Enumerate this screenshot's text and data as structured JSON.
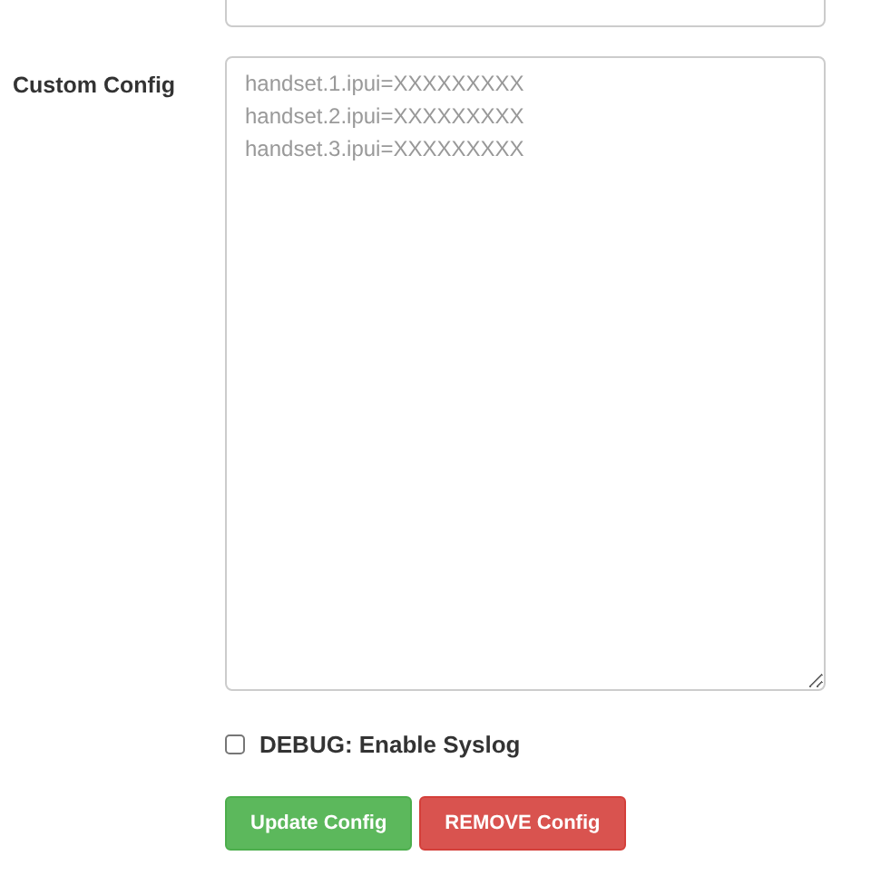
{
  "custom_config": {
    "label": "Custom Config",
    "placeholder": "handset.1.ipui=XXXXXXXXX\nhandset.2.ipui=XXXXXXXXX\nhandset.3.ipui=XXXXXXXXX"
  },
  "debug": {
    "label": "DEBUG: Enable Syslog",
    "checked": false
  },
  "buttons": [
    {
      "label": "Update Config",
      "kind": "success"
    },
    {
      "label": "REMOVE Config",
      "kind": "danger"
    }
  ]
}
